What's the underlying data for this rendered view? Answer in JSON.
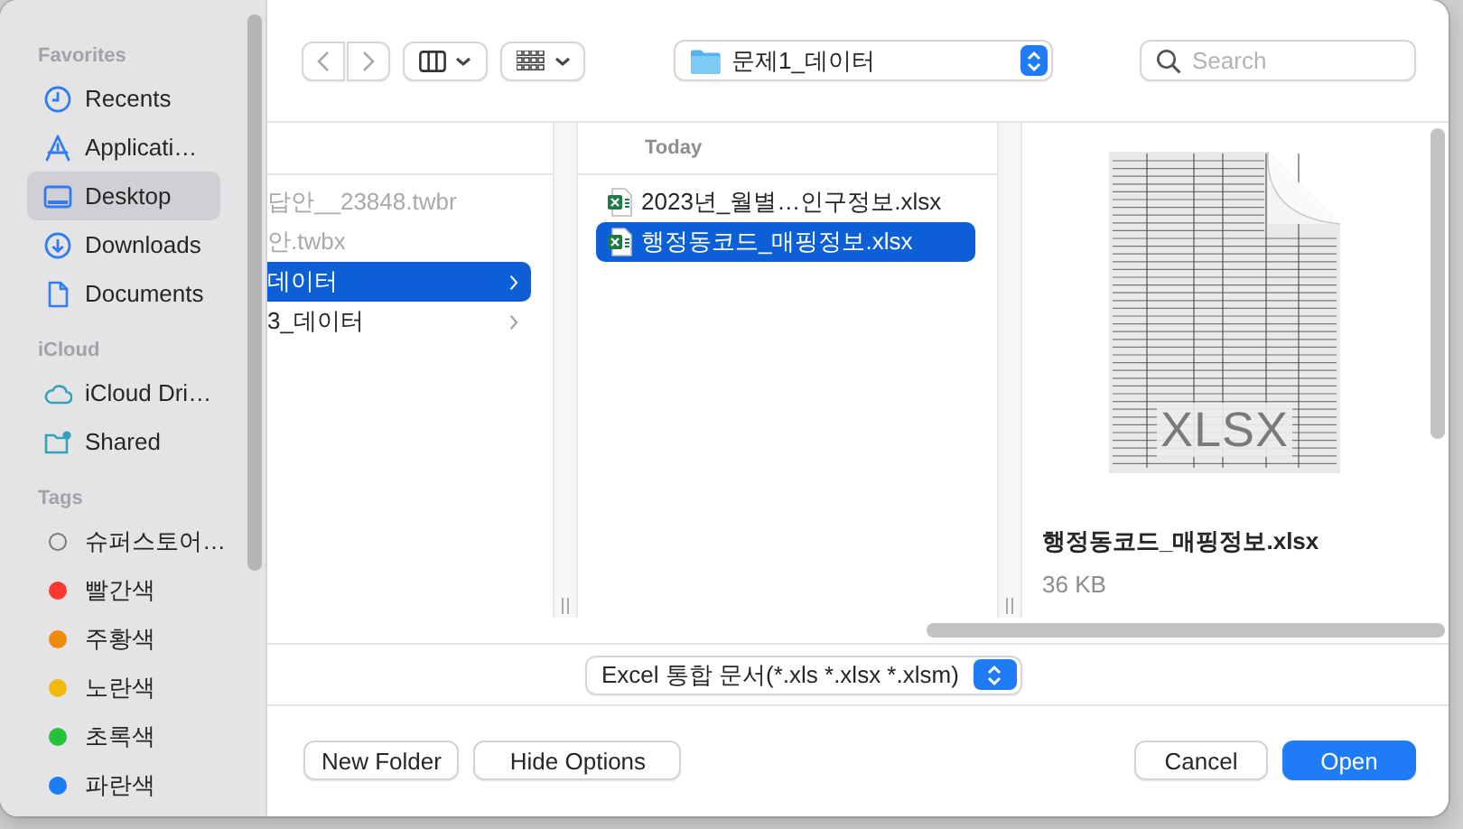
{
  "sidebar": {
    "sections": [
      {
        "title": "Favorites",
        "items": [
          {
            "label": "Recents",
            "kind": "clock",
            "selected": false
          },
          {
            "label": "Applicati…",
            "kind": "apps",
            "selected": false
          },
          {
            "label": "Desktop",
            "kind": "desktop",
            "selected": true
          },
          {
            "label": "Downloads",
            "kind": "download",
            "selected": false
          },
          {
            "label": "Documents",
            "kind": "document",
            "selected": false
          }
        ]
      },
      {
        "title": "iCloud",
        "items": [
          {
            "label": "iCloud Dri…",
            "kind": "cloud",
            "selected": false
          },
          {
            "label": "Shared",
            "kind": "shared",
            "selected": false
          }
        ]
      },
      {
        "title": "Tags",
        "items": [
          {
            "label": "슈퍼스토어…",
            "kind": "tag",
            "selected": false
          },
          {
            "label": "빨간색",
            "kind": "tag",
            "color": "#fb3731",
            "selected": false
          },
          {
            "label": "주황색",
            "kind": "tag",
            "color": "#f08a0c",
            "selected": false
          },
          {
            "label": "노란색",
            "kind": "tag",
            "color": "#f2b90d",
            "selected": false
          },
          {
            "label": "초록색",
            "kind": "tag",
            "color": "#27c13c",
            "selected": false
          },
          {
            "label": "파란색",
            "kind": "tag",
            "color": "#1a7cf7",
            "selected": false
          }
        ]
      }
    ]
  },
  "toolbar": {
    "path": "문제1_데이터",
    "search": {
      "placeholder": "Search"
    }
  },
  "browser": {
    "columns": [
      {
        "items": [
          {
            "label": "답안__23848.twbr",
            "kind": "file",
            "disabled": true,
            "selected": false
          },
          {
            "label": "안.twbx",
            "kind": "file",
            "disabled": true,
            "selected": false
          },
          {
            "label": "데이터",
            "kind": "folder",
            "disabled": false,
            "selected": true
          },
          {
            "label": "3_데이터",
            "kind": "folder",
            "disabled": false,
            "selected": false
          }
        ]
      },
      {
        "header": "Today",
        "items": [
          {
            "label": "2023년_월별…인구정보.xlsx",
            "kind": "xlsx",
            "disabled": false,
            "selected": false
          },
          {
            "label": "행정동코드_매핑정보.xlsx",
            "kind": "xlsx",
            "disabled": false,
            "selected": true
          }
        ]
      }
    ],
    "preview": {
      "badge": "XLSX",
      "name": "행정동코드_매핑정보.xlsx",
      "size": "36 KB"
    }
  },
  "footer": {
    "format": "Excel 통합 문서(*.xls *.xlsx *.xlsm)",
    "left_buttons": [
      {
        "label": "New Folder",
        "default": false
      },
      {
        "label": "Hide Options",
        "default": false
      }
    ],
    "right_buttons": [
      {
        "label": "Cancel",
        "default": false
      },
      {
        "label": "Open",
        "default": true
      }
    ]
  }
}
